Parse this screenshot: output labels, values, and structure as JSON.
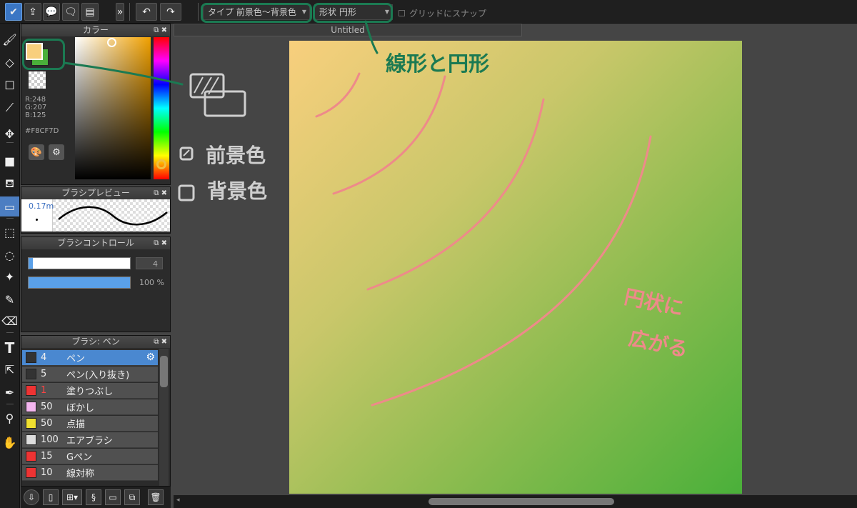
{
  "toolbar": {
    "icons": [
      "check-icon",
      "upload-icon",
      "speech-icon",
      "comment-icon",
      "document-icon",
      "expand-icon",
      "undo-icon",
      "redo-icon"
    ],
    "type_label": "タイプ",
    "type_value": "前景色〜背景色",
    "shape_label": "形状",
    "shape_value": "円形",
    "snap_label": "グリッドにスナップ"
  },
  "panels": {
    "color": {
      "title": "カラー",
      "r": "R:248",
      "g": "G:207",
      "b": "B:125",
      "hex": "#F8CF7D",
      "fg_color": "#F8CF7D",
      "bg_color": "#4AB03A"
    },
    "brush_preview": {
      "title": "ブラシプレビュー",
      "size": "0.17m"
    },
    "brush_control": {
      "title": "ブラシコントロール",
      "size_value": "4",
      "opacity_value": "100 %",
      "size_level": 0.04,
      "opacity_level": 1.0
    },
    "brush_list": {
      "title": "ブラシ: ペン",
      "items": [
        {
          "num": "4",
          "name": "ペン",
          "color": "#333333",
          "selected": true
        },
        {
          "num": "5",
          "name": "ペン(入り抜き)",
          "color": "#333333"
        },
        {
          "num": "1",
          "name": "塗りつぶし",
          "color": "#ee3333",
          "num_red": true
        },
        {
          "num": "50",
          "name": "ぼかし",
          "color": "#f4b6f0"
        },
        {
          "num": "50",
          "name": "点描",
          "color": "#f0e030"
        },
        {
          "num": "100",
          "name": "エアブラシ",
          "color": "#dddddd"
        },
        {
          "num": "15",
          "name": "Gペン",
          "color": "#ee3333"
        },
        {
          "num": "10",
          "name": "線対称",
          "color": "#ee3333"
        }
      ]
    }
  },
  "document": {
    "tab_title": "Untitled"
  },
  "annotations": {
    "shape_note": "線形と円形",
    "fg_label": "前景色",
    "bg_label": "背景色",
    "spread_note_line1": "円状に",
    "spread_note_line2": "広がる",
    "annot_color": "#3a3a3a",
    "green_color": "#1b7a52",
    "pink_color": "#ee8a8a"
  }
}
